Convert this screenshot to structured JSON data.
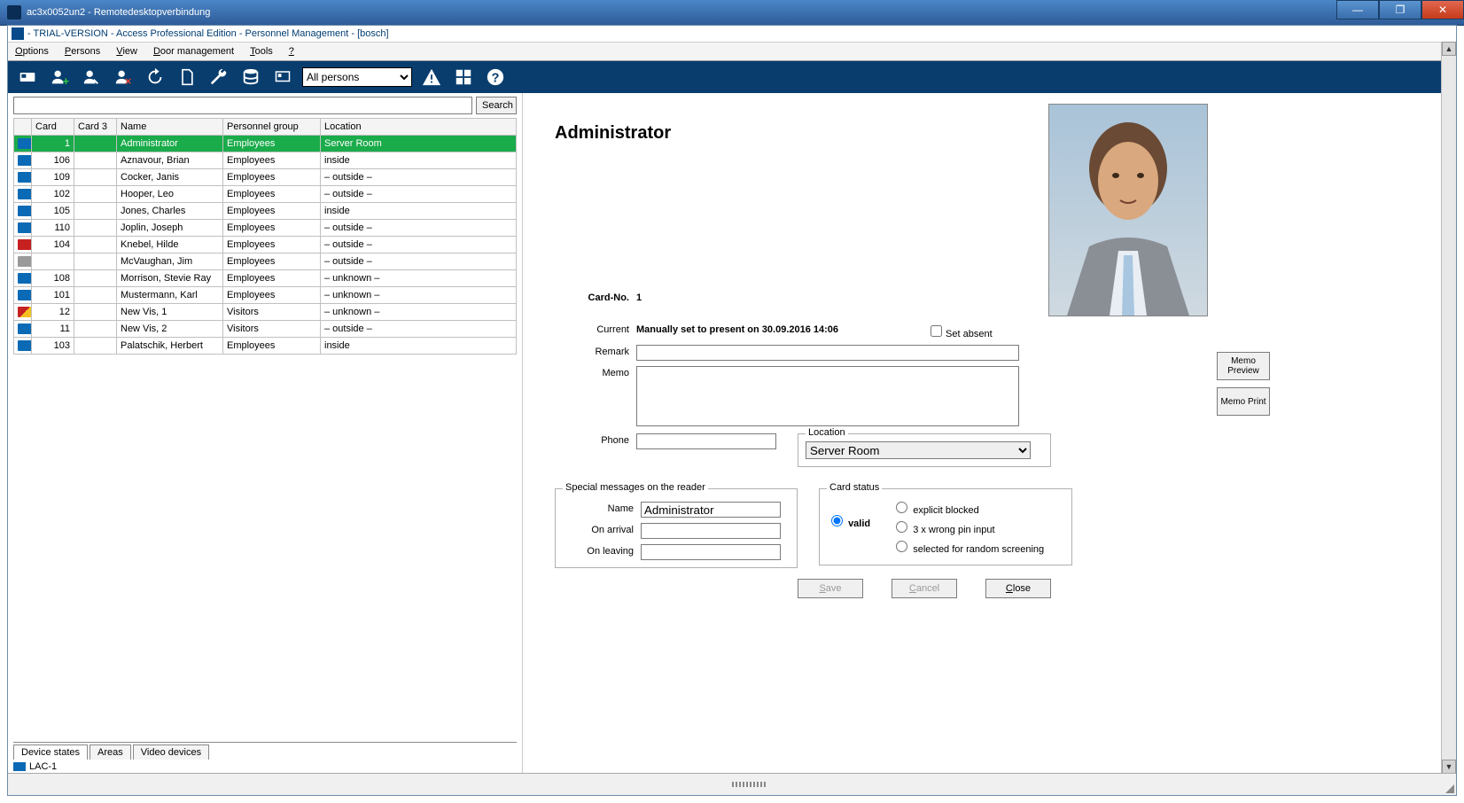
{
  "window": {
    "title": "ac3x0052un2 - Remotedesktopverbindung",
    "inner_title": " - TRIAL-VERSION - Access Professional Edition - Personnel Management - [bosch]"
  },
  "menu": [
    "Options",
    "Persons",
    "View",
    "Door management",
    "Tools",
    "?"
  ],
  "toolbar": {
    "filter": "All persons"
  },
  "search": {
    "button": "Search"
  },
  "grid": {
    "headers": {
      "card": "Card",
      "card3": "Card 3",
      "name": "Name",
      "pg": "Personnel group",
      "loc": "Location"
    },
    "rows": [
      {
        "icon": "ic-blue",
        "card": "1",
        "card3": "",
        "name": "Administrator",
        "pg": "Employees",
        "loc": "Server Room",
        "sel": true
      },
      {
        "icon": "ic-blue",
        "card": "106",
        "card3": "",
        "name": "Aznavour, Brian",
        "pg": "Employees",
        "loc": "inside"
      },
      {
        "icon": "ic-blue",
        "card": "109",
        "card3": "",
        "name": "Cocker, Janis",
        "pg": "Employees",
        "loc": "– outside –"
      },
      {
        "icon": "ic-blue",
        "card": "102",
        "card3": "",
        "name": "Hooper, Leo",
        "pg": "Employees",
        "loc": "– outside –"
      },
      {
        "icon": "ic-blue",
        "card": "105",
        "card3": "",
        "name": "Jones, Charles",
        "pg": "Employees",
        "loc": "inside"
      },
      {
        "icon": "ic-blue",
        "card": "110",
        "card3": "",
        "name": "Joplin, Joseph",
        "pg": "Employees",
        "loc": "– outside –"
      },
      {
        "icon": "ic-red",
        "card": "104",
        "card3": "",
        "name": "Knebel, Hilde",
        "pg": "Employees",
        "loc": "– outside –"
      },
      {
        "icon": "ic-grey",
        "card": "",
        "card3": "",
        "name": "McVaughan, Jim",
        "pg": "Employees",
        "loc": "– outside –"
      },
      {
        "icon": "ic-blue",
        "card": "108",
        "card3": "",
        "name": "Morrison, Stevie Ray",
        "pg": "Employees",
        "loc": "– unknown –"
      },
      {
        "icon": "ic-blue",
        "card": "101",
        "card3": "",
        "name": "Mustermann, Karl",
        "pg": "Employees",
        "loc": "– unknown –"
      },
      {
        "icon": "ic-warn",
        "card": "12",
        "card3": "",
        "name": "New Vis, 1",
        "pg": "Visitors",
        "loc": "– unknown –"
      },
      {
        "icon": "ic-blue",
        "card": "11",
        "card3": "",
        "name": "New Vis, 2",
        "pg": "Visitors",
        "loc": "– outside –"
      },
      {
        "icon": "ic-blue",
        "card": "103",
        "card3": "",
        "name": "Palatschik, Herbert",
        "pg": "Employees",
        "loc": "inside"
      }
    ]
  },
  "tabs": {
    "device_states": "Device states",
    "areas": "Areas",
    "video": "Video devices",
    "lac": "LAC-1"
  },
  "detail": {
    "title": "Administrator",
    "card_label": "Card-No.",
    "card_value": "1",
    "current_label": "Current",
    "current_value": "Manually set to present on 30.09.2016 14:06",
    "set_absent": "Set absent",
    "remark_label": "Remark",
    "memo_label": "Memo",
    "phone_label": "Phone",
    "location_label": "Location",
    "location_value": "Server Room",
    "memo_preview": "Memo Preview",
    "memo_print": "Memo Print",
    "special_legend": "Special messages on the reader",
    "sp_name_label": "Name",
    "sp_name_value": "Administrator",
    "sp_arrival": "On arrival",
    "sp_leaving": "On leaving",
    "cardstatus_legend": "Card status",
    "valid": "valid",
    "blocked": "explicit blocked",
    "wrongpin": "3 x wrong pin input",
    "screening": "selected for random screening",
    "save": "Save",
    "cancel": "Cancel",
    "close": "Close"
  }
}
